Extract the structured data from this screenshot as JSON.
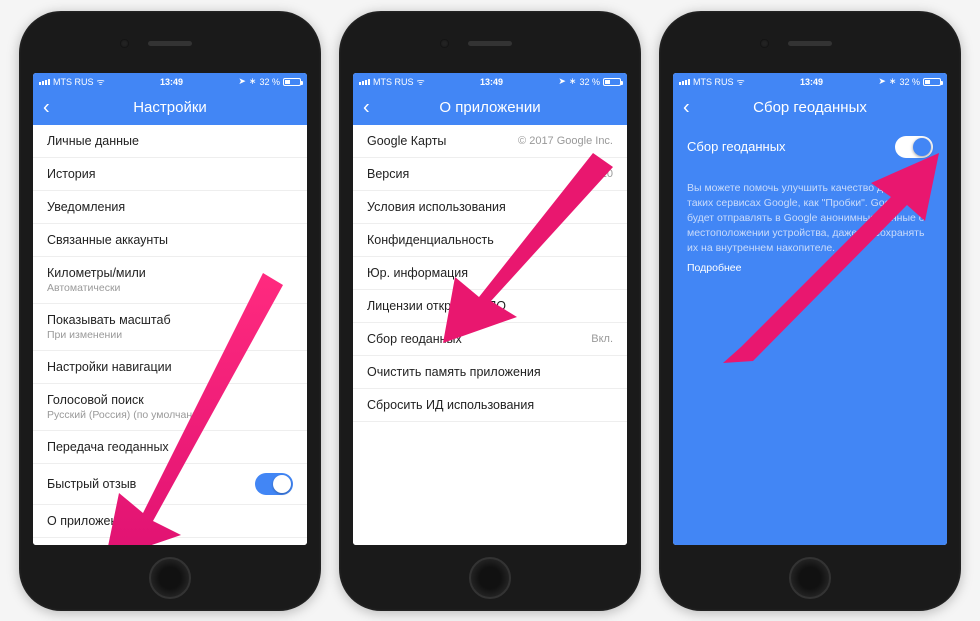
{
  "status": {
    "carrier": "MTS RUS",
    "time": "13:49",
    "battery": "32 %",
    "bt_icon": "✱",
    "arrow_icon": "✈"
  },
  "phone1": {
    "title": "Настройки",
    "rows": [
      {
        "label": "Личные данные"
      },
      {
        "label": "История"
      },
      {
        "label": "Уведомления"
      },
      {
        "label": "Связанные аккаунты"
      },
      {
        "label": "Километры/мили",
        "sub": "Автоматически"
      },
      {
        "label": "Показывать масштаб",
        "sub": "При изменении"
      },
      {
        "label": "Настройки навигации"
      },
      {
        "label": "Голосовой поиск",
        "sub": "Русский (Россия) (по умолчанию)"
      },
      {
        "label": "Передача геоданных"
      },
      {
        "label": "Быстрый отзыв",
        "toggle": true
      },
      {
        "label": "О приложении"
      }
    ]
  },
  "phone2": {
    "title": "О приложении",
    "rows": [
      {
        "label": "Google Карты",
        "val": "© 2017 Google Inc."
      },
      {
        "label": "Версия",
        "val": "4.41.10"
      },
      {
        "label": "Условия использования"
      },
      {
        "label": "Конфиденциальность"
      },
      {
        "label": "Юр. информация"
      },
      {
        "label": "Лицензии открытого ПО"
      },
      {
        "label": "Сбор геоданных",
        "val": "Вкл."
      },
      {
        "label": "Очистить память приложения"
      },
      {
        "label": "Сбросить ИД использования"
      }
    ]
  },
  "phone3": {
    "title": "Сбор геоданных",
    "toggle_label": "Сбор геоданных",
    "description": "Вы можете помочь улучшить качество данных в таких сервисах Google, как \"Пробки\". Google будет отправлять в Google анонимные данные о местоположении устройства, даже не сохранять их на внутреннем накопителе.",
    "link": "Подробнее"
  }
}
